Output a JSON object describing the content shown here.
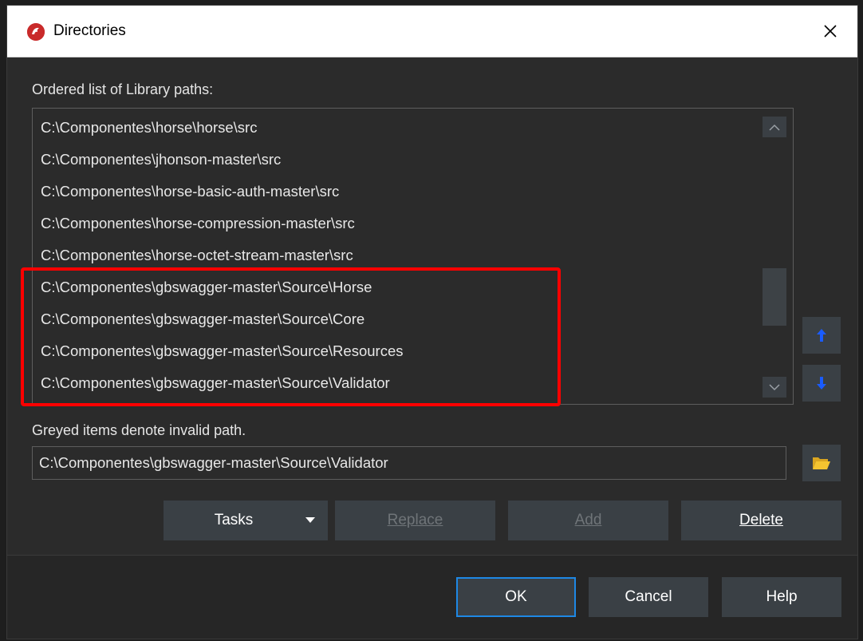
{
  "window": {
    "title": "Directories",
    "icon": "app-logo-icon",
    "close_glyph": "✕"
  },
  "library_label": "Ordered list of Library paths:",
  "paths": [
    "C:\\Componentes\\horse\\horse\\src",
    "C:\\Componentes\\jhonson-master\\src",
    "C:\\Componentes\\horse-basic-auth-master\\src",
    "C:\\Componentes\\horse-compression-master\\src",
    "C:\\Componentes\\horse-octet-stream-master\\src",
    "C:\\Componentes\\gbswagger-master\\Source\\Horse",
    "C:\\Componentes\\gbswagger-master\\Source\\Core",
    "C:\\Componentes\\gbswagger-master\\Source\\Resources",
    "C:\\Componentes\\gbswagger-master\\Source\\Validator"
  ],
  "invalid_note": "Greyed items denote invalid path.",
  "path_input": {
    "value": "C:\\Componentes\\gbswagger-master\\Source\\Validator"
  },
  "buttons": {
    "tasks": "Tasks",
    "replace": "Replace",
    "add": "Add",
    "delete": "Delete",
    "ok": "OK",
    "cancel": "Cancel",
    "help": "Help"
  },
  "colors": {
    "accent": "#1e88e5",
    "highlight": "#ff0000",
    "arrow": "#1a5cff",
    "folder": "#f4c430"
  }
}
